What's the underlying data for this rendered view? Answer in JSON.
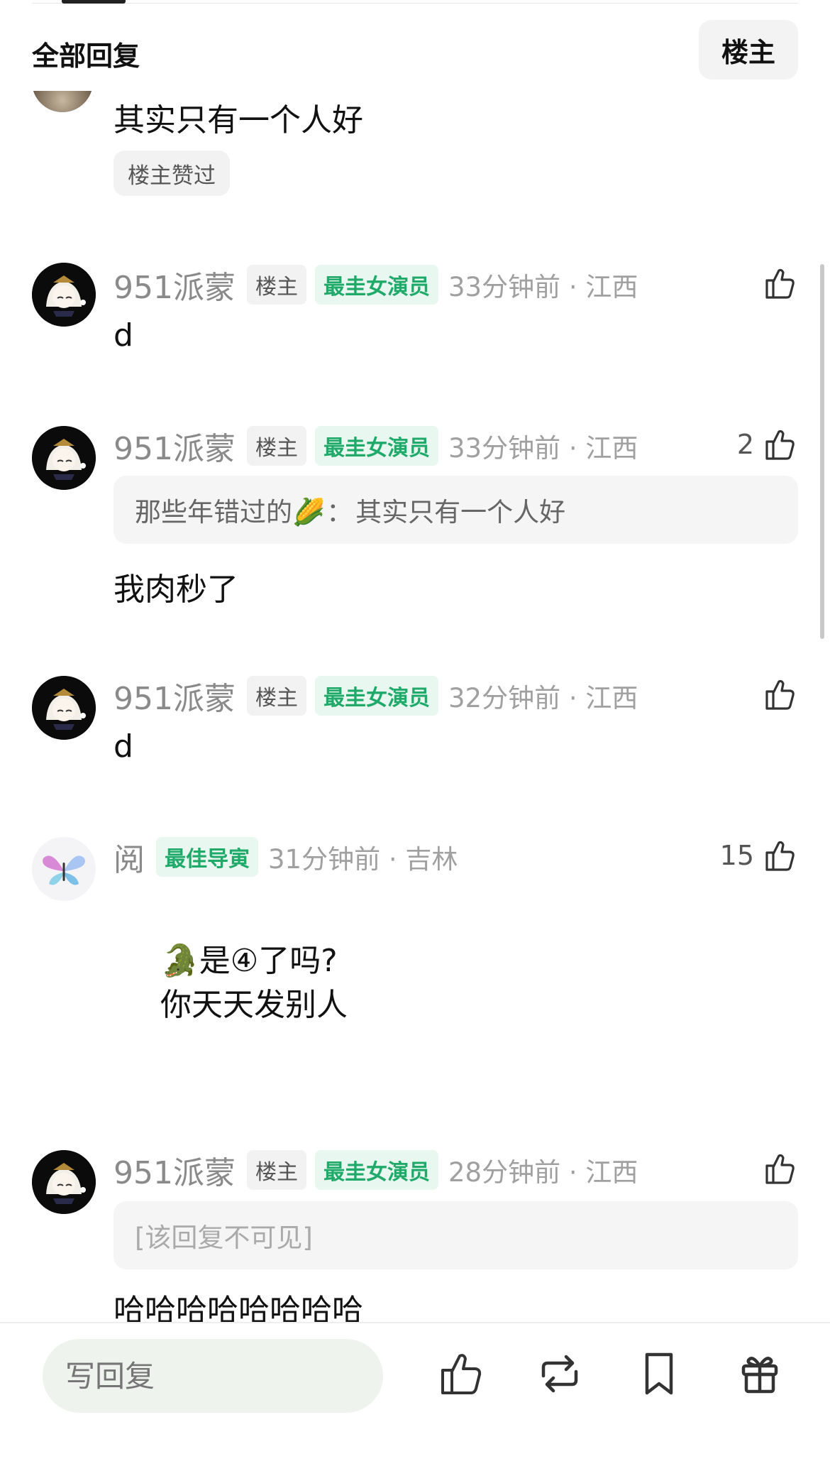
{
  "header": {
    "title": "全部回复",
    "filter_button": "楼主"
  },
  "top_reply": {
    "text": "其实只有一个人好",
    "badge": "楼主赞过"
  },
  "comments": [
    {
      "username": "951派蒙",
      "tag_owner": "楼主",
      "tag_award": "最圭女演员",
      "time": "33分钟前 · 江西",
      "likes": "",
      "text": "d"
    },
    {
      "username": "951派蒙",
      "tag_owner": "楼主",
      "tag_award": "最圭女演员",
      "time": "33分钟前 · 江西",
      "likes": "2",
      "quote_name": "那些年错过的🌽",
      "quote_sep": "：",
      "quote_text": "其实只有一个人好",
      "text": "我肉秒了"
    },
    {
      "username": "951派蒙",
      "tag_owner": "楼主",
      "tag_award": "最圭女演员",
      "time": "32分钟前 · 江西",
      "likes": "",
      "text": "d"
    },
    {
      "username": "阅",
      "tag_award": "最佳导寅",
      "time": "31分钟前 · 吉林",
      "likes": "15",
      "image_line1": "🐊是④了吗?",
      "image_line2": "你天天发别人"
    },
    {
      "username": "951派蒙",
      "tag_owner": "楼主",
      "tag_award": "最圭女演员",
      "time": "28分钟前 · 江西",
      "likes": "",
      "quote_hidden": "[该回复不可见]",
      "text": "哈哈哈哈哈哈哈哈"
    }
  ],
  "bottom_bar": {
    "reply_placeholder": "写回复"
  },
  "icons": {
    "like": "thumbs-up-icon",
    "repost": "repost-icon",
    "bookmark": "bookmark-icon",
    "gift": "gift-icon"
  },
  "colors": {
    "award_green": "#1faa6a",
    "award_bg": "#e8f7ef",
    "input_bg": "#eef3ee"
  }
}
